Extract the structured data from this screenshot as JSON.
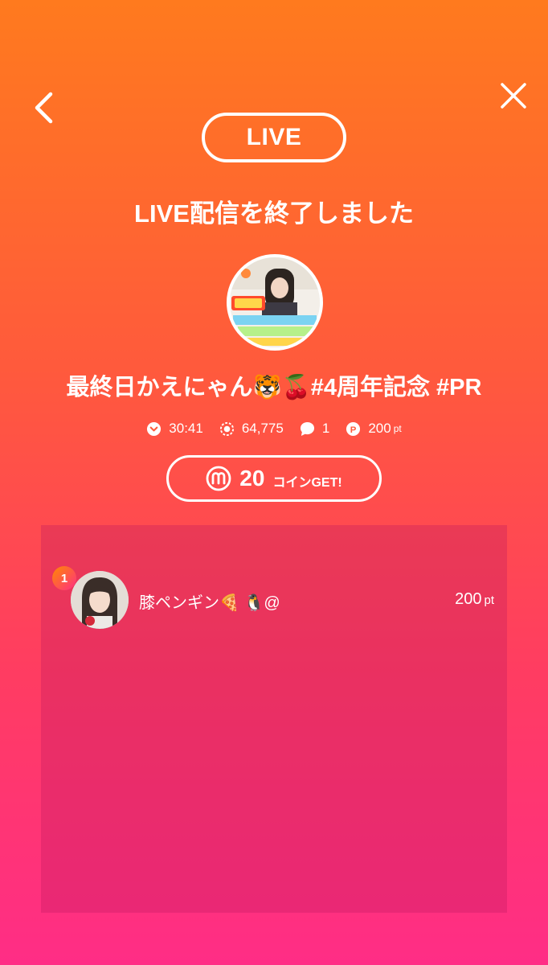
{
  "header": {
    "back_icon": "chevron-left-icon",
    "close_icon": "close-icon",
    "live_label": "LIVE"
  },
  "main": {
    "end_message": "LIVE配信を終了しました",
    "stream_title": "最終日かえにゃん🐯🍒#4周年記念 #PR",
    "stats": {
      "duration": "30:41",
      "views": "64,775",
      "comments": "1",
      "points": "200",
      "points_unit": "pt"
    },
    "coin": {
      "amount": "20",
      "label": "コインGET!"
    }
  },
  "ranking": {
    "items": [
      {
        "rank": "1",
        "name": "膝ペンギン🍕 🐧@",
        "points": "200",
        "unit": "pt"
      }
    ]
  },
  "colors": {
    "gradient_top": "#ff7a1e",
    "gradient_bottom": "#ff2d86"
  }
}
